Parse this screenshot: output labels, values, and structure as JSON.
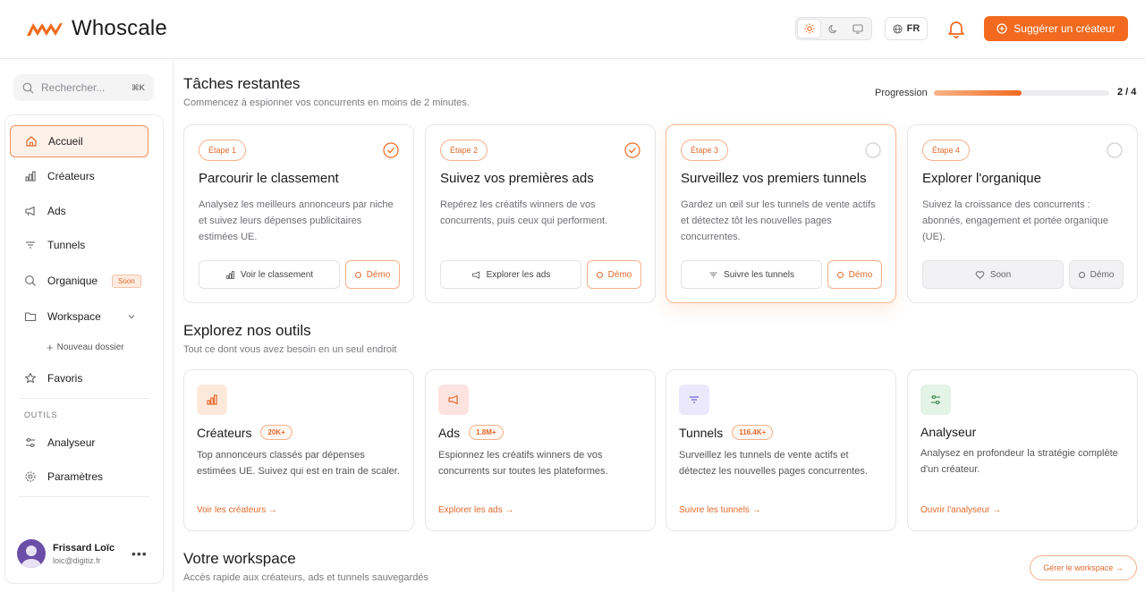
{
  "header": {
    "brand": "Whoscale",
    "lang": "FR",
    "suggest_label": "Suggérer un créateur",
    "theme_modes": [
      "light-icon",
      "dark-icon",
      "system-icon"
    ],
    "accent": "#f26a1f"
  },
  "sidebar": {
    "search_placeholder": "Rechercher...",
    "search_shortcut": "⌘K",
    "items": [
      {
        "label": "Accueil",
        "icon": "home-icon"
      },
      {
        "label": "Créateurs",
        "icon": "bar-chart-icon"
      },
      {
        "label": "Ads",
        "icon": "megaphone-icon"
      },
      {
        "label": "Tunnels",
        "icon": "filter-icon"
      },
      {
        "label": "Organique",
        "icon": "search-icon",
        "badge": "Soon"
      },
      {
        "label": "Workspace",
        "icon": "folder-icon"
      },
      {
        "label": "Favoris",
        "icon": "star-icon"
      }
    ],
    "new_folder": "Nouveau dossier",
    "tools_label": "OUTILS",
    "tools": [
      {
        "label": "Analyseur",
        "icon": "sliders-icon"
      },
      {
        "label": "Paramètres",
        "icon": "gear-icon"
      }
    ],
    "user": {
      "name": "Frissard Loïc",
      "email": "loic@digitiz.fr"
    }
  },
  "tasks": {
    "title": "Tâches restantes",
    "subtitle": "Commencez à espionner vos concurrents en moins de 2 minutes.",
    "progress_label": "Progression",
    "progress_count": "2 / 4",
    "progress_fraction": 0.5,
    "steps": [
      {
        "badge": "Étape 1",
        "title": "Parcourir le classement",
        "desc": "Analysez les meilleurs annonceurs par niche et suivez leurs dépenses publicitaires estimées UE.",
        "action": "Voir le classement",
        "demo": "Démo",
        "done": true
      },
      {
        "badge": "Étape 2",
        "title": "Suivez vos premières ads",
        "desc": "Repérez les créatifs winners de vos concurrents, puis ceux qui performent.",
        "action": "Explorer les ads",
        "demo": "Démo",
        "done": true
      },
      {
        "badge": "Étape 3",
        "title": "Surveillez vos premiers tunnels",
        "desc": "Gardez un œil sur les tunnels de vente actifs et détectez tôt les nouvelles pages concurrentes.",
        "action": "Suivre les tunnels",
        "demo": "Démo",
        "done": false
      },
      {
        "badge": "Étape 4",
        "title": "Explorer l'organique",
        "desc": "Suivez la croissance des concurrents : abonnés, engagement et portée organique (UE).",
        "action": "Soon",
        "demo": "Démo",
        "done": false
      }
    ]
  },
  "tools": {
    "title": "Explorez nos outils",
    "subtitle": "Tout ce dont vous avez besoin en un seul endroit",
    "cards": [
      {
        "title": "Créateurs",
        "count": "20K+",
        "desc": "Top annonceurs classés par dépenses estimées UE. Suivez qui est en train de scaler.",
        "link": "Voir les créateurs →",
        "icon": "bar-chart-icon",
        "tint": "#fde9dc"
      },
      {
        "title": "Ads",
        "count": "1.8M+",
        "desc": "Espionnez les créatifs winners de vos concurrents sur toutes les plateformes.",
        "link": "Explorer les ads →",
        "icon": "megaphone-icon",
        "tint": "#fde3e0"
      },
      {
        "title": "Tunnels",
        "count": "116.4K+",
        "desc": "Surveillez les tunnels de vente actifs et détectez les nouvelles pages concurrentes.",
        "link": "Suivre les tunnels →",
        "icon": "filter-icon",
        "tint": "#ebe8fb"
      },
      {
        "title": "Analyseur",
        "count": "",
        "desc": "Analysez en profondeur la stratégie complète d'un créateur.",
        "link": "Ouvrir l'analyseur →",
        "icon": "sliders-icon",
        "tint": "#e3f3e6"
      }
    ]
  },
  "workspace": {
    "title": "Votre workspace",
    "subtitle": "Accès rapide aux créateurs, ads et tunnels sauvegardés",
    "manage_label": "Gérer le workspace →"
  }
}
